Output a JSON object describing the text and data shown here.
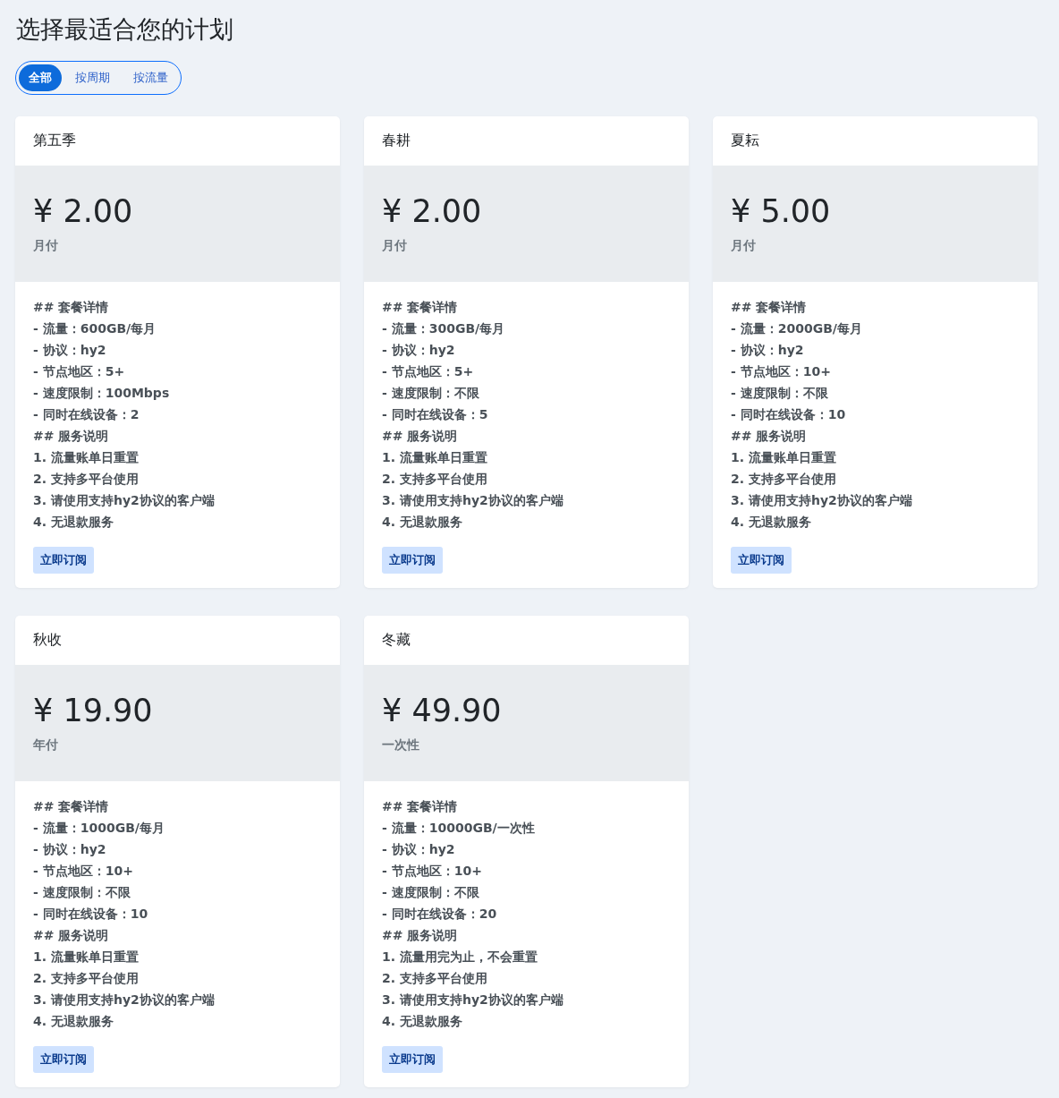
{
  "title": "选择最适合您的计划",
  "tabs": [
    {
      "label": "全部",
      "selected": true
    },
    {
      "label": "按周期",
      "selected": false
    },
    {
      "label": "按流量",
      "selected": false
    }
  ],
  "plans": [
    {
      "name": "第五季",
      "price": "¥ 2.00",
      "period": "月付",
      "details": [
        "## 套餐详情",
        "- 流量：600GB/每月",
        "- 协议：hy2",
        "- 节点地区：5+",
        "- 速度限制：100Mbps",
        "- 同时在线设备：2",
        "## 服务说明",
        "1. 流量账单日重置",
        "2. 支持多平台使用",
        "3. 请使用支持hy2协议的客户端",
        "4. 无退款服务"
      ],
      "button": "立即订阅"
    },
    {
      "name": "春耕",
      "price": "¥ 2.00",
      "period": "月付",
      "details": [
        "## 套餐详情",
        "- 流量：300GB/每月",
        "- 协议：hy2",
        "- 节点地区：5+",
        "- 速度限制：不限",
        "- 同时在线设备：5",
        "## 服务说明",
        "1. 流量账单日重置",
        "2. 支持多平台使用",
        "3. 请使用支持hy2协议的客户端",
        "4. 无退款服务"
      ],
      "button": "立即订阅"
    },
    {
      "name": "夏耘",
      "price": "¥ 5.00",
      "period": "月付",
      "details": [
        "## 套餐详情",
        "- 流量：2000GB/每月",
        "- 协议：hy2",
        "- 节点地区：10+",
        "- 速度限制：不限",
        "- 同时在线设备：10",
        "## 服务说明",
        "1. 流量账单日重置",
        "2. 支持多平台使用",
        "3. 请使用支持hy2协议的客户端",
        "4. 无退款服务"
      ],
      "button": "立即订阅"
    },
    {
      "name": "秋收",
      "price": "¥ 19.90",
      "period": "年付",
      "details": [
        "## 套餐详情",
        "- 流量：1000GB/每月",
        "- 协议：hy2",
        "- 节点地区：10+",
        "- 速度限制：不限",
        "- 同时在线设备：10",
        "## 服务说明",
        "1. 流量账单日重置",
        "2. 支持多平台使用",
        "3. 请使用支持hy2协议的客户端",
        "4. 无退款服务"
      ],
      "button": "立即订阅"
    },
    {
      "name": "冬藏",
      "price": "¥ 49.90",
      "period": "一次性",
      "details": [
        "## 套餐详情",
        "- 流量：10000GB/一次性",
        "- 协议：hy2",
        "- 节点地区：10+",
        "- 速度限制：不限",
        "- 同时在线设备：20",
        "## 服务说明",
        "1. 流量用完为止，不会重置",
        "2. 支持多平台使用",
        "3. 请使用支持hy2协议的客户端",
        "4. 无退款服务"
      ],
      "button": "立即订阅"
    }
  ]
}
